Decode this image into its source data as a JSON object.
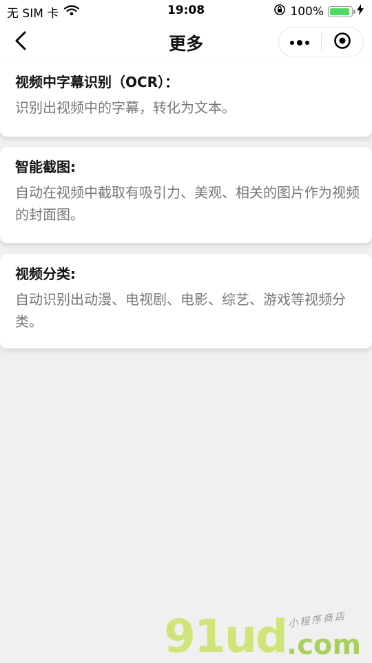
{
  "status_bar": {
    "carrier": "无 SIM 卡",
    "time": "19:08",
    "battery_percent": "100%",
    "battery_level": 1.0,
    "icons": [
      "wifi-icon",
      "orientation-lock-icon",
      "battery-icon",
      "charging-bolt-icon"
    ]
  },
  "nav": {
    "title": "更多",
    "back_icon": "chevron-left-icon",
    "more_icon": "more-dots-icon",
    "close_icon": "target-circle-icon"
  },
  "cards": [
    {
      "title": "视频中字幕识别（OCR）：",
      "description": "识别出视频中的字幕，转化为文本。"
    },
    {
      "title": "智能截图:",
      "description": "自动在视频中截取有吸引力、美观、相关的图片作为视频的封面图。"
    },
    {
      "title": "视频分类:",
      "description": "自动识别出动漫、电视剧、电影、综艺、游戏等视频分类。"
    }
  ],
  "watermark": {
    "main": "91ud",
    "domain": ".com",
    "sub": "小程序商店"
  },
  "colors": {
    "background": "#f0f0f0",
    "card": "#ffffff",
    "description": "#777777",
    "battery": "#4cd964",
    "watermark": "#cfe57a"
  }
}
